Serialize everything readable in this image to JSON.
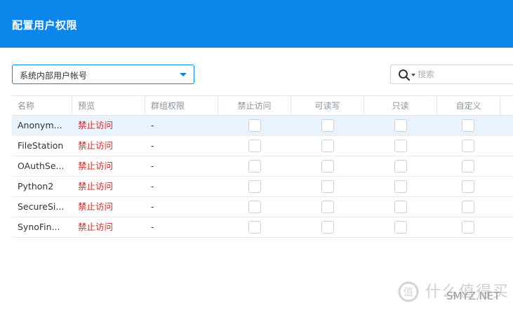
{
  "window": {
    "title": "配置用户权限"
  },
  "filter": {
    "selected": "系统内部用户帐号"
  },
  "search": {
    "placeholder": "搜索",
    "value": ""
  },
  "table": {
    "columns": {
      "name": "名称",
      "preview": "预览",
      "group": "群组权限",
      "deny": "禁止访问",
      "readwrite": "可读写",
      "readonly": "只读",
      "custom": "自定义"
    },
    "rows": [
      {
        "name": "Anonym...",
        "preview": "禁止访问",
        "group": "-"
      },
      {
        "name": "FileStation",
        "preview": "禁止访问",
        "group": "-"
      },
      {
        "name": "OAuthSe...",
        "preview": "禁止访问",
        "group": "-"
      },
      {
        "name": "Python2",
        "preview": "禁止访问",
        "group": "-"
      },
      {
        "name": "SecureSi...",
        "preview": "禁止访问",
        "group": "-"
      },
      {
        "name": "SynoFin...",
        "preview": "禁止访问",
        "group": "-"
      }
    ]
  },
  "watermark": {
    "text": "什么值得买",
    "sub": "SMYZ.NET"
  },
  "colors": {
    "accent": "#0b86ea",
    "deny": "#c4302b",
    "selected_row": "#e8f3fd"
  }
}
